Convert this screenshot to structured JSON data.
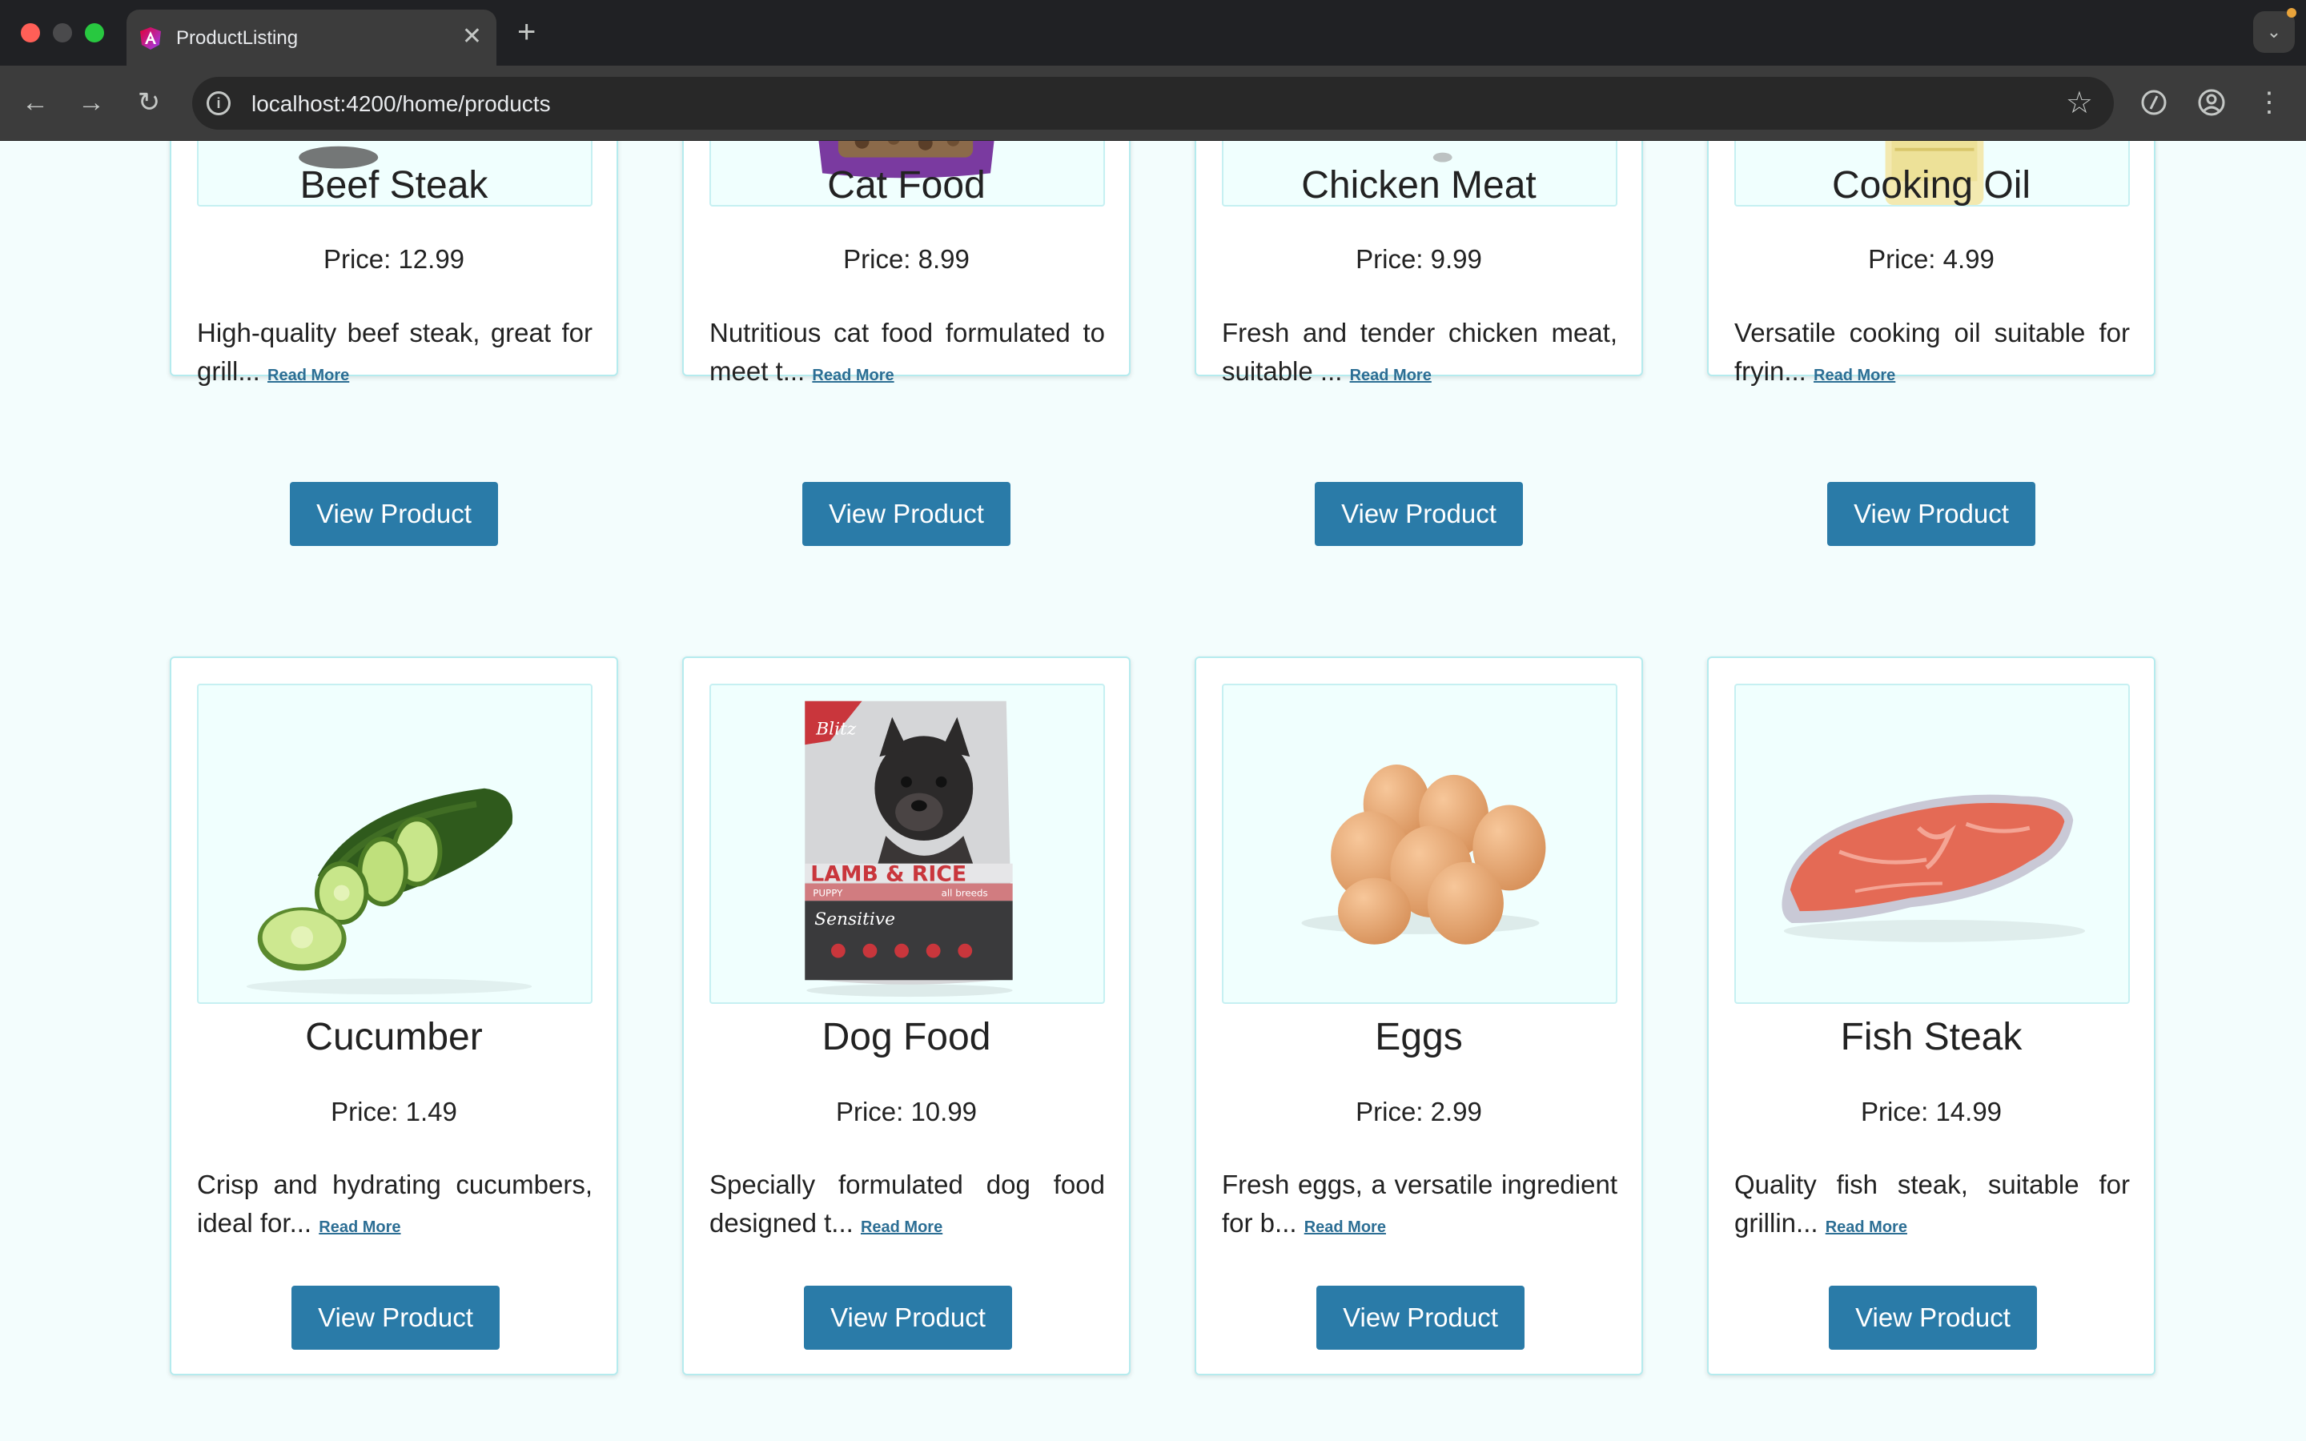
{
  "browser": {
    "tab_title": "ProductListing",
    "url": "localhost:4200/home/products"
  },
  "products": [
    {
      "name": "Beef Steak",
      "price": "Price: 12.99",
      "description": "High-quality beef steak, great for grill...",
      "read_more": "Read More",
      "button": "View Product",
      "image": "beef-steak-image"
    },
    {
      "name": "Cat Food",
      "price": "Price: 8.99",
      "description": "Nutritious cat food formulated to meet t...",
      "read_more": "Read More",
      "button": "View Product",
      "image": "cat-food-image"
    },
    {
      "name": "Chicken Meat",
      "price": "Price: 9.99",
      "description": "Fresh and tender chicken meat, suitable ...",
      "read_more": "Read More",
      "button": "View Product",
      "image": "chicken-meat-image"
    },
    {
      "name": "Cooking Oil",
      "price": "Price: 4.99",
      "description": "Versatile cooking oil suitable for fryin...",
      "read_more": "Read More",
      "button": "View Product",
      "image": "cooking-oil-image"
    },
    {
      "name": "Cucumber",
      "price": "Price: 1.49",
      "description": "Crisp and hydrating cucumbers, ideal for...",
      "read_more": "Read More",
      "button": "View Product",
      "image": "cucumber-image"
    },
    {
      "name": "Dog Food",
      "price": "Price: 10.99",
      "description": "Specially formulated dog food designed t...",
      "read_more": "Read More",
      "button": "View Product",
      "image": "dog-food-image",
      "package_text": {
        "brand": "Blitz",
        "line1": "LAMB & RICE",
        "line2": "PUPPY",
        "line3": "all breeds",
        "line4": "Sensitive"
      }
    },
    {
      "name": "Eggs",
      "price": "Price: 2.99",
      "description": "Fresh eggs, a versatile ingredient for b...",
      "read_more": "Read More",
      "button": "View Product",
      "image": "eggs-image"
    },
    {
      "name": "Fish Steak",
      "price": "Price: 14.99",
      "description": "Quality fish steak, suitable for grillin...",
      "read_more": "Read More",
      "button": "View Product",
      "image": "fish-steak-image"
    }
  ],
  "colors": {
    "page_background": "#f3fdfd",
    "button": "#2a7ba8",
    "link": "#2c6e94",
    "card_border": "#b5ebee"
  }
}
